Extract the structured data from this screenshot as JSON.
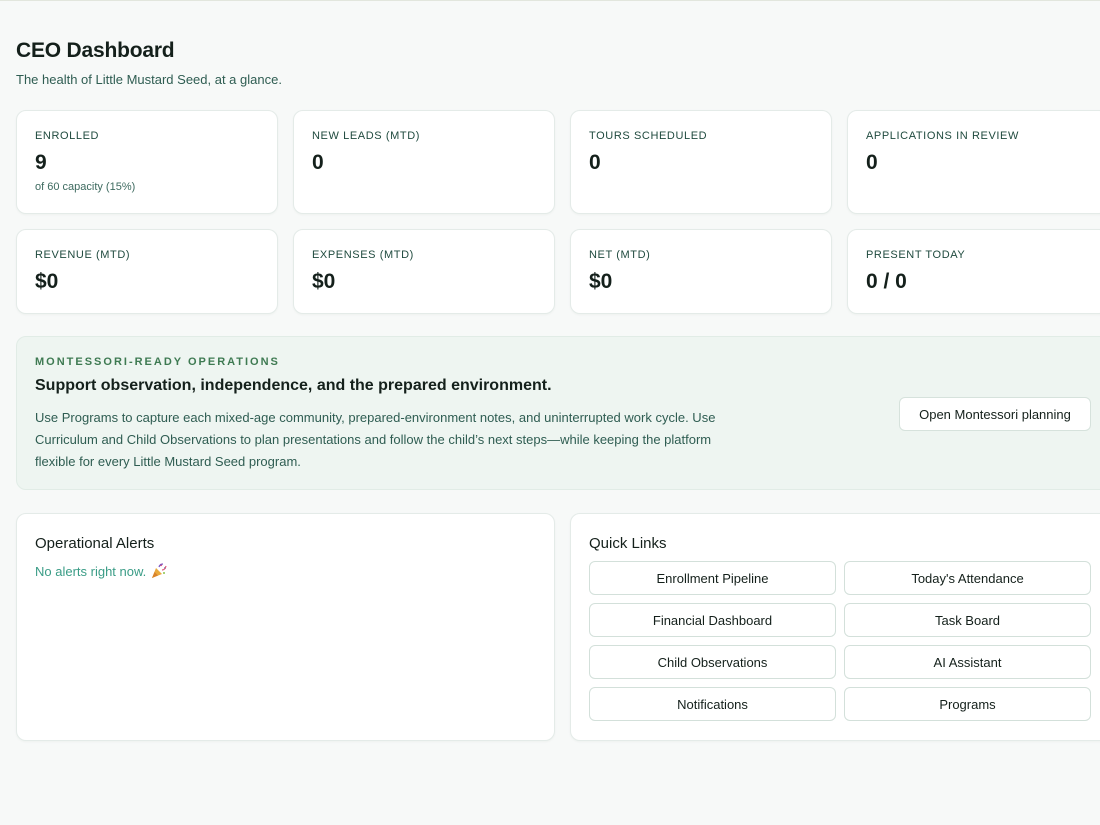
{
  "header": {
    "title": "CEO Dashboard",
    "subtitle": "The health of Little Mustard Seed, at a glance."
  },
  "stats": [
    {
      "label": "ENROLLED",
      "value": "9",
      "note": "of 60 capacity (15%)"
    },
    {
      "label": "NEW LEADS (MTD)",
      "value": "0"
    },
    {
      "label": "TOURS SCHEDULED",
      "value": "0"
    },
    {
      "label": "APPLICATIONS IN REVIEW",
      "value": "0"
    },
    {
      "label": "REVENUE (MTD)",
      "value": "$0"
    },
    {
      "label": "EXPENSES (MTD)",
      "value": "$0"
    },
    {
      "label": "NET (MTD)",
      "value": "$0"
    },
    {
      "label": "PRESENT TODAY",
      "value": "0 / 0"
    }
  ],
  "montessori": {
    "eyebrow": "MONTESSORI-READY OPERATIONS",
    "heading": "Support observation, independence, and the prepared environment.",
    "body": "Use Programs to capture each mixed-age community, prepared-environment notes, and uninterrupted work cycle. Use Curriculum and Child Observations to plan presentations and follow the child’s next steps—while keeping the platform flexible for every Little Mustard Seed program.",
    "button_label": "Open Montessori planning"
  },
  "alerts": {
    "title": "Operational Alerts",
    "empty_text": "No alerts right now.",
    "empty_icon": "party-popper-icon"
  },
  "quick_links": {
    "title": "Quick Links",
    "items": [
      {
        "label": "Enrollment Pipeline"
      },
      {
        "label": "Today's Attendance"
      },
      {
        "label": "Financial Dashboard"
      },
      {
        "label": "Task Board"
      },
      {
        "label": "Child Observations"
      },
      {
        "label": "AI Assistant"
      },
      {
        "label": "Notifications"
      },
      {
        "label": "Programs"
      }
    ]
  },
  "colors": {
    "background": "#f7f9f8",
    "accent_green": "#3e7a52",
    "teal_text": "#2f5d52",
    "alert_teal": "#3a9c86",
    "banner_bg": "#eef5f1"
  }
}
